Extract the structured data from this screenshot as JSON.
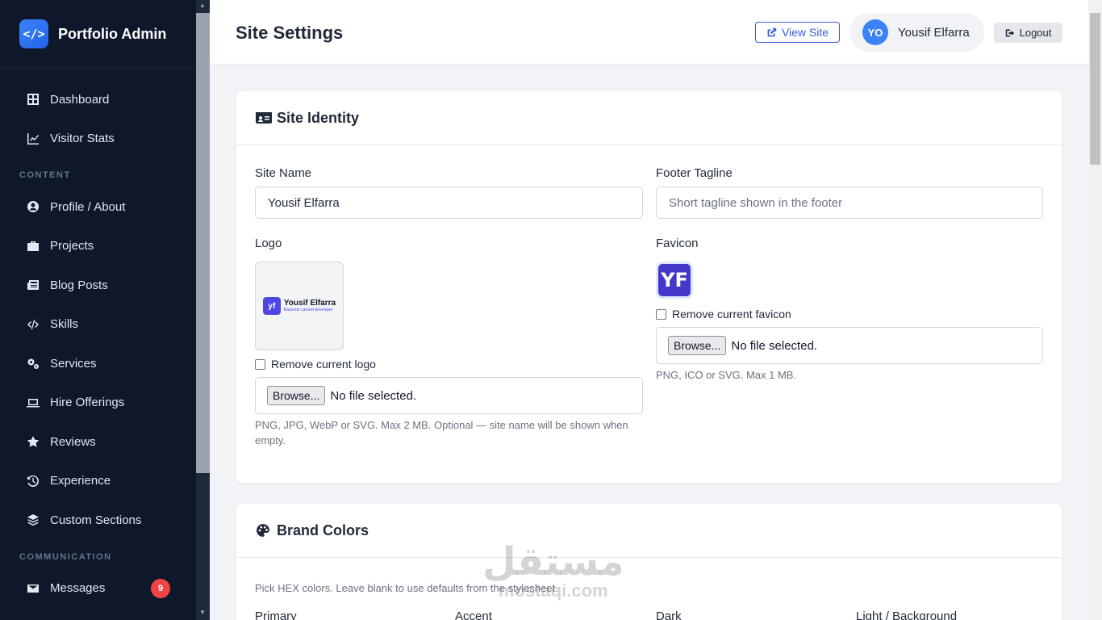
{
  "brand": {
    "logo_glyph": "</>",
    "name": "Portfolio Admin"
  },
  "sidebar": {
    "items_top": [
      {
        "label": "Dashboard",
        "icon": "grid-icon"
      },
      {
        "label": "Visitor Stats",
        "icon": "chart-line-icon"
      }
    ],
    "section_content": "CONTENT",
    "items_content": [
      {
        "label": "Profile / About",
        "icon": "user-circle-icon"
      },
      {
        "label": "Projects",
        "icon": "briefcase-icon"
      },
      {
        "label": "Blog Posts",
        "icon": "newspaper-icon"
      },
      {
        "label": "Skills",
        "icon": "code-icon"
      },
      {
        "label": "Services",
        "icon": "cogs-icon"
      },
      {
        "label": "Hire Offerings",
        "icon": "laptop-icon"
      },
      {
        "label": "Reviews",
        "icon": "star-icon"
      },
      {
        "label": "Experience",
        "icon": "history-icon"
      },
      {
        "label": "Custom Sections",
        "icon": "layers-icon"
      }
    ],
    "section_communication": "COMMUNICATION",
    "items_communication": [
      {
        "label": "Messages",
        "icon": "envelope-icon",
        "badge": "9"
      }
    ]
  },
  "header": {
    "title": "Site Settings",
    "view_site": "View Site",
    "user_initials": "YO",
    "user_name": "Yousif Elfarra",
    "logout": "Logout"
  },
  "identity": {
    "title": "Site Identity",
    "site_name_label": "Site Name",
    "site_name_value": "Yousif Elfarra",
    "tagline_label": "Footer Tagline",
    "tagline_placeholder": "Short tagline shown in the footer",
    "logo_label": "Logo",
    "logo_preview_mark": "yf",
    "logo_preview_name": "Yousif Elfarra",
    "logo_preview_sub": "Backend Laravel developer",
    "remove_logo": "Remove current logo",
    "browse": "Browse...",
    "no_file": "No file selected.",
    "logo_hint": "PNG, JPG, WebP or SVG. Max 2 MB. Optional — site name will be shown when empty.",
    "favicon_label": "Favicon",
    "favicon_text": "YF",
    "remove_favicon": "Remove current favicon",
    "favicon_hint": "PNG, ICO or SVG. Max 1 MB."
  },
  "colors": {
    "title": "Brand Colors",
    "intro": "Pick HEX colors. Leave blank to use defaults from the stylesheet.",
    "fields": [
      "Primary",
      "Accent",
      "Dark",
      "Light / Background"
    ]
  },
  "watermark": {
    "arabic": "مستقل",
    "latin": "mostaqi.com"
  },
  "theme": {
    "sidebar_bg": "#0f172a",
    "primary": "#3b5bdb",
    "badge": "#ef4444"
  }
}
